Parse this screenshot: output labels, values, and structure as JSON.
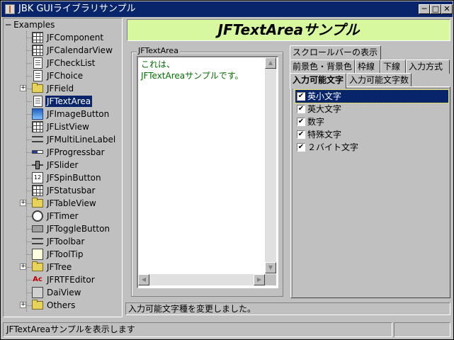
{
  "window": {
    "title": "JBK GUIライブラリサンプル",
    "title_bar_color": "#08246b",
    "controls": [
      "minimize-icon",
      "maximize-icon",
      "close-icon"
    ]
  },
  "tree": {
    "root": "Examples",
    "items": [
      {
        "label": "JFComponent",
        "icon": "grid-icon",
        "expandable": false
      },
      {
        "label": "JFCalendarView",
        "icon": "calendar-icon",
        "expandable": false
      },
      {
        "label": "JFCheckList",
        "icon": "checklist-icon",
        "expandable": false
      },
      {
        "label": "JFChoice",
        "icon": "choice-icon",
        "expandable": false
      },
      {
        "label": "JFField",
        "icon": "folder-icon",
        "expandable": true
      },
      {
        "label": "JFTextArea",
        "icon": "textarea-icon",
        "expandable": false,
        "selected": true
      },
      {
        "label": "JFImageButton",
        "icon": "image-icon",
        "expandable": false
      },
      {
        "label": "JFListView",
        "icon": "listview-icon",
        "expandable": false
      },
      {
        "label": "JFMultiLineLabel",
        "icon": "multiline-icon",
        "expandable": false
      },
      {
        "label": "JFProgressbar",
        "icon": "progressbar-icon",
        "expandable": false
      },
      {
        "label": "JFSlider",
        "icon": "slider-icon",
        "expandable": false
      },
      {
        "label": "JFSpinButton",
        "icon": "spin-icon",
        "expandable": false
      },
      {
        "label": "JFStatusbar",
        "icon": "statusbar-icon",
        "expandable": false
      },
      {
        "label": "JFTableView",
        "icon": "folder-icon",
        "expandable": true
      },
      {
        "label": "JFTimer",
        "icon": "clock-icon",
        "expandable": false
      },
      {
        "label": "JFToggleButton",
        "icon": "toggle-icon",
        "expandable": false
      },
      {
        "label": "JFToolbar",
        "icon": "toolbar-icon",
        "expandable": false
      },
      {
        "label": "JFToolTip",
        "icon": "tooltip-icon",
        "expandable": false
      },
      {
        "label": "JFTree",
        "icon": "folder-icon",
        "expandable": true
      },
      {
        "label": "JFRTFEditor",
        "icon": "rtf-icon",
        "expandable": false
      },
      {
        "label": "DaiView",
        "icon": "daiview-icon",
        "expandable": false
      },
      {
        "label": "Others",
        "icon": "folder-icon",
        "expandable": true
      }
    ]
  },
  "banner": {
    "title": "JFTextAreaサンプル",
    "bg_color": "#d8f8a0"
  },
  "textarea_group": {
    "legend": "JFTextArea",
    "line1": "これは、",
    "line2": "JFTextAreaサンプルです。",
    "text_color": "#007000"
  },
  "tabs": {
    "row1": [
      "スクロールバーの表示"
    ],
    "row2": [
      "前景色・背景色",
      "枠線",
      "下線",
      "入力方式"
    ],
    "row3": [
      "入力可能文字",
      "入力可能文字数"
    ],
    "active": "入力可能文字"
  },
  "checklist": [
    {
      "label": "英小文字",
      "checked": true,
      "selected": true
    },
    {
      "label": "英大文字",
      "checked": true
    },
    {
      "label": "数字",
      "checked": true
    },
    {
      "label": "特殊文字",
      "checked": true
    },
    {
      "label": "２バイト文字",
      "checked": true
    }
  ],
  "message": "入力可能文字種を変更しました。",
  "statusbar": {
    "text": "JFTextAreaサンプルを表示します"
  }
}
